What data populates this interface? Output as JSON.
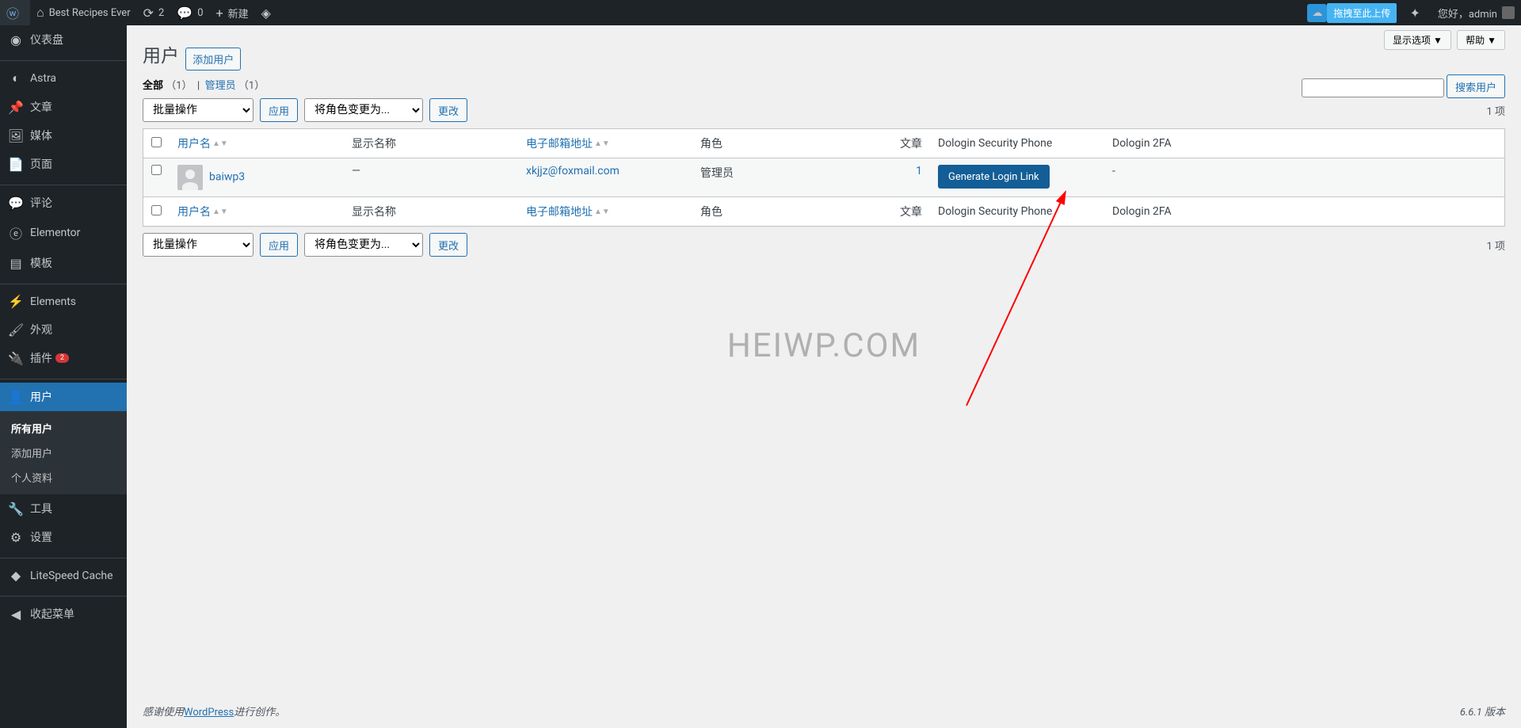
{
  "adminbar": {
    "site_name": "Best Recipes Ever",
    "updates_count": "2",
    "comments_count": "0",
    "new_label": "新建",
    "upload_label": "拖拽至此上传",
    "howdy": "您好，admin"
  },
  "sidebar": {
    "items": [
      {
        "icon": "dashboard",
        "label": "仪表盘"
      },
      {
        "icon": "astra",
        "label": "Astra"
      },
      {
        "icon": "pin",
        "label": "文章"
      },
      {
        "icon": "media",
        "label": "媒体"
      },
      {
        "icon": "page",
        "label": "页面"
      },
      {
        "icon": "comment",
        "label": "评论"
      },
      {
        "icon": "elementor",
        "label": "Elementor"
      },
      {
        "icon": "template",
        "label": "模板"
      },
      {
        "icon": "elements",
        "label": "Elements"
      },
      {
        "icon": "brush",
        "label": "外观"
      },
      {
        "icon": "plugin",
        "label": "插件",
        "badge": "2"
      },
      {
        "icon": "user",
        "label": "用户",
        "current": true
      },
      {
        "icon": "tool",
        "label": "工具"
      },
      {
        "icon": "settings",
        "label": "设置"
      },
      {
        "icon": "litespeed",
        "label": "LiteSpeed Cache"
      },
      {
        "icon": "collapse",
        "label": "收起菜单"
      }
    ],
    "submenu": [
      {
        "label": "所有用户",
        "current": true
      },
      {
        "label": "添加用户"
      },
      {
        "label": "个人资料"
      }
    ]
  },
  "screen": {
    "options": "显示选项",
    "help": "帮助"
  },
  "page": {
    "title": "用户",
    "add_new": "添加用户",
    "filters": {
      "all_label": "全部",
      "all_count": "（1）",
      "admin_label": "管理员",
      "admin_count": "（1）"
    },
    "search_btn": "搜索用户",
    "bulk_placeholder": "批量操作",
    "apply": "应用",
    "role_placeholder": "将角色变更为...",
    "change": "更改",
    "count": "1 项"
  },
  "table": {
    "cols": {
      "username": "用户名",
      "display": "显示名称",
      "email": "电子邮箱地址",
      "role": "角色",
      "posts": "文章",
      "phone": "Dologin Security Phone",
      "twofa": "Dologin 2FA"
    },
    "rows": [
      {
        "username": "baiwp3",
        "display": "—",
        "email": "xkjjz@foxmail.com",
        "role": "管理员",
        "posts": "1",
        "phone_btn": "Generate Login Link",
        "twofa": "-"
      }
    ]
  },
  "watermark": "HEIWP.COM",
  "footer": {
    "thanks_prefix": "感谢使用",
    "wp": "WordPress",
    "thanks_suffix": "进行创作。",
    "version": "6.6.1 版本"
  }
}
